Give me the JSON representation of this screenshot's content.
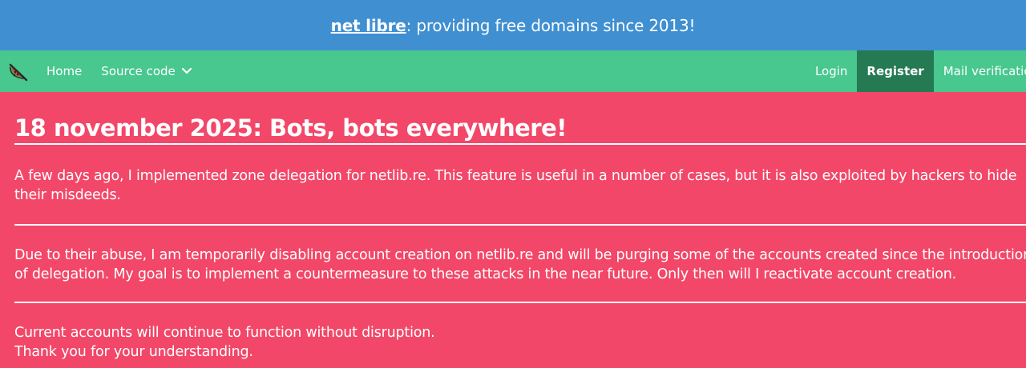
{
  "banner": {
    "brand": "net libre",
    "tagline": ": providing free domains since 2013!"
  },
  "nav": {
    "logo_icon": "watermelon-icon",
    "left": [
      {
        "label": "Home"
      },
      {
        "label": "Source code"
      }
    ],
    "right": [
      {
        "label": "Login"
      },
      {
        "label": "Register"
      },
      {
        "label": "Mail verification"
      }
    ]
  },
  "post": {
    "title": "18 november 2025: Bots, bots everywhere!",
    "p1_line1": "A few days ago, I implemented zone delegation for netlib.re. This feature is useful in a number of cases, but it is also exploited by hackers to hide",
    "p1_line2": "their misdeeds.",
    "p2_line1": "Due to their abuse, I am temporarily disabling account creation on netlib.re and will be purging some of the accounts created since the introduction",
    "p2_line2": "of delegation. My goal is to implement a countermeasure to these attacks in the near future. Only then will I reactivate account creation.",
    "p3_line1": "Current accounts will continue to function without disruption.",
    "p3_line2": "Thank you for your understanding."
  },
  "colors": {
    "banner": "#3f8fd1",
    "navbar": "#48c78e",
    "register": "#257953",
    "page": "#f24768"
  }
}
